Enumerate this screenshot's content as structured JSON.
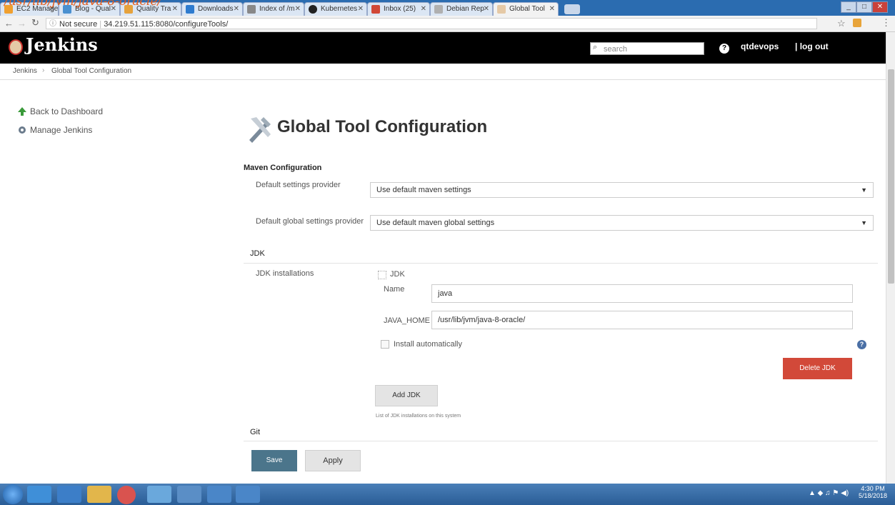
{
  "overlay_text": "/usr/lib/jvm/java-8-oracle/",
  "browser": {
    "tabs": [
      {
        "label": "EC2 Manage"
      },
      {
        "label": "Blog - Qual"
      },
      {
        "label": "Quality Tra"
      },
      {
        "label": "Downloads"
      },
      {
        "label": "Index of /m"
      },
      {
        "label": "Kubernetes"
      },
      {
        "label": "Inbox (25)"
      },
      {
        "label": "Debian Rep"
      },
      {
        "label": "Global Tool"
      }
    ],
    "url_security": "Not secure",
    "url": "34.219.51.115:8080/configureTools/"
  },
  "header": {
    "logo": "Jenkins",
    "search_placeholder": "search",
    "help": "?",
    "user": "qtdevops",
    "logout": "| log out"
  },
  "breadcrumb": {
    "items": [
      "Jenkins",
      "Global Tool Configuration"
    ],
    "separator": "›"
  },
  "sidebar": {
    "items": [
      {
        "label": "Back to Dashboard"
      },
      {
        "label": "Manage Jenkins"
      }
    ]
  },
  "page": {
    "title": "Global Tool Configuration",
    "maven": {
      "heading": "Maven Configuration",
      "default_settings_label": "Default settings provider",
      "default_settings_value": "Use default maven settings",
      "global_settings_label": "Default global settings provider",
      "global_settings_value": "Use default maven global settings"
    },
    "jdk": {
      "heading": "JDK",
      "installations_label": "JDK installations",
      "item_header": "JDK",
      "name_label": "Name",
      "name_value": "java",
      "java_home_label": "JAVA_HOME",
      "java_home_value": "/usr/lib/jvm/java-8-oracle/",
      "install_auto_label": "Install automatically",
      "delete_button": "Delete JDK",
      "add_button": "Add JDK",
      "hint": "List of JDK installations on this system"
    },
    "git_heading": "Git",
    "save_button": "Save",
    "apply_button": "Apply"
  },
  "taskbar": {
    "time": "4:30 PM",
    "date": "5/18/2018"
  },
  "colors": {
    "jenkins_header": "#000000",
    "delete_button": "#d24939",
    "save_button": "#4b758b",
    "taskbar": "#2a5d96"
  }
}
